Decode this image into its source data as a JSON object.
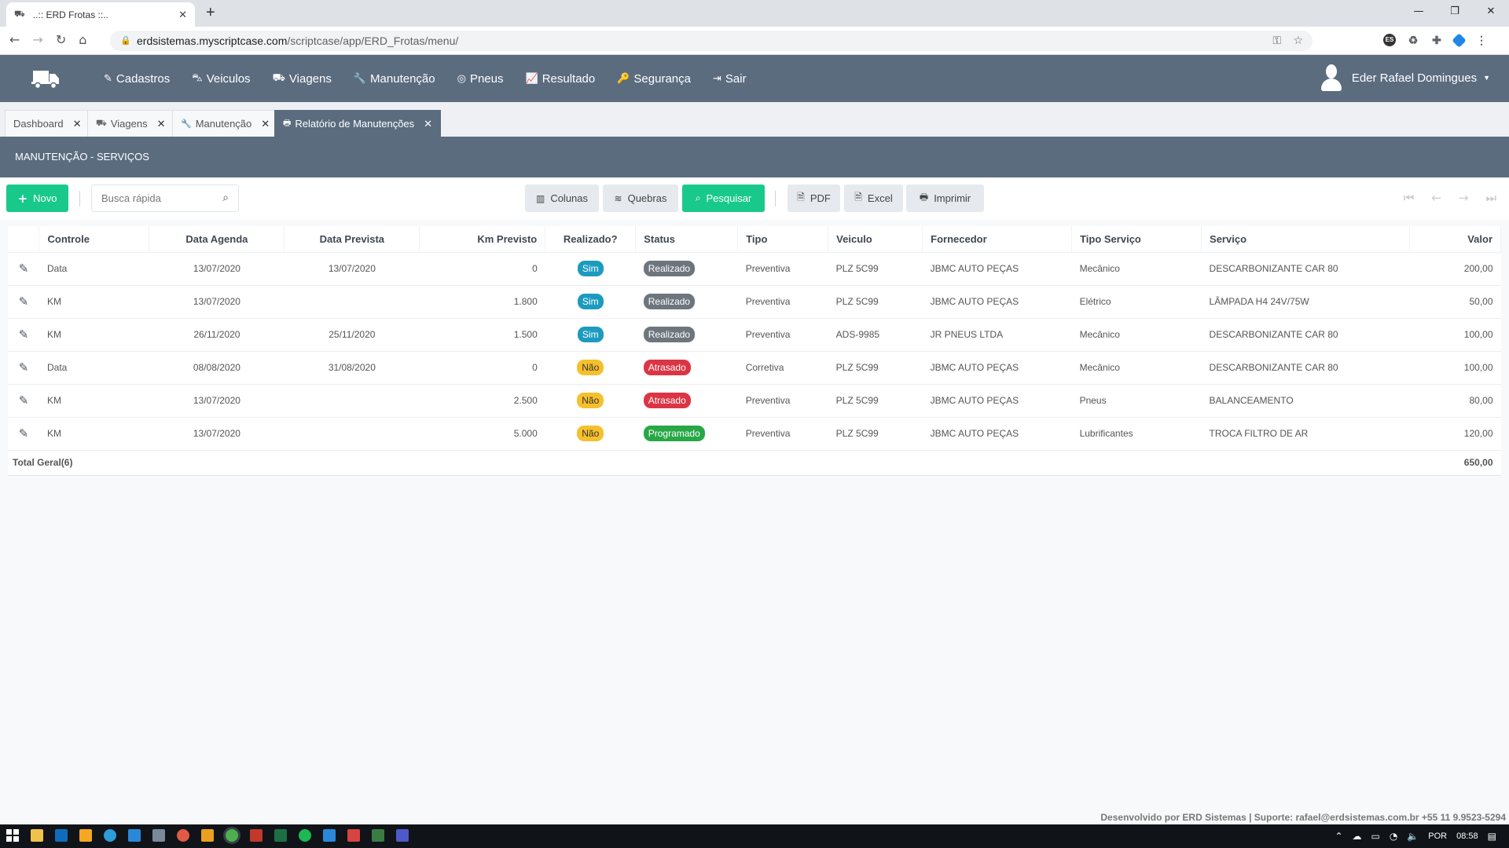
{
  "browser": {
    "tab_title": "..:: ERD Frotas ::..",
    "url_domain": "erdsistemas.myscriptcase.com",
    "url_path": "/scriptcase/app/ERD_Frotas/menu/"
  },
  "nav": {
    "items": [
      {
        "label": "Cadastros",
        "icon": "edit-icon"
      },
      {
        "label": "Veiculos",
        "icon": "car-icon"
      },
      {
        "label": "Viagens",
        "icon": "truck-icon"
      },
      {
        "label": "Manutenção",
        "icon": "wrench-icon"
      },
      {
        "label": "Pneus",
        "icon": "life-ring-icon"
      },
      {
        "label": "Resultado",
        "icon": "chart-icon"
      },
      {
        "label": "Segurança",
        "icon": "key-icon"
      },
      {
        "label": "Sair",
        "icon": "sign-out-icon"
      }
    ],
    "user_name": "Eder Rafael Domingues"
  },
  "app_tabs": [
    {
      "label": "Dashboard",
      "icon": ""
    },
    {
      "label": "Viagens",
      "icon": "truck-icon"
    },
    {
      "label": "Manutenção",
      "icon": "wrench-icon"
    },
    {
      "label": "Relatório de Manutenções",
      "icon": "print-icon"
    }
  ],
  "page_title": "MANUTENÇÃO - SERVIÇOS",
  "toolbar": {
    "new_label": "Novo",
    "search_placeholder": "Busca rápida",
    "columns_label": "Colunas",
    "breaks_label": "Quebras",
    "search_label": "Pesquisar",
    "pdf_label": "PDF",
    "excel_label": "Excel",
    "print_label": "Imprimir"
  },
  "table": {
    "headers": [
      "Controle",
      "Data Agenda",
      "Data Prevista",
      "Km Previsto",
      "Realizado?",
      "Status",
      "Tipo",
      "Veiculo",
      "Fornecedor",
      "Tipo Serviço",
      "Serviço",
      "Valor"
    ],
    "rows": [
      {
        "controle": "Data",
        "data_agenda": "13/07/2020",
        "data_prevista": "13/07/2020",
        "km": "0",
        "realizado": "Sim",
        "status": "Realizado",
        "tipo": "Preventiva",
        "veiculo": "PLZ 5C99",
        "fornecedor": "JBMC AUTO PEÇAS",
        "tipo_servico": "Mecânico",
        "servico": "DESCARBONIZANTE CAR 80",
        "valor": "200,00"
      },
      {
        "controle": "KM",
        "data_agenda": "13/07/2020",
        "data_prevista": "",
        "km": "1.800",
        "realizado": "Sim",
        "status": "Realizado",
        "tipo": "Preventiva",
        "veiculo": "PLZ 5C99",
        "fornecedor": "JBMC AUTO PEÇAS",
        "tipo_servico": "Elétrico",
        "servico": "LÂMPADA H4 24V/75W",
        "valor": "50,00"
      },
      {
        "controle": "KM",
        "data_agenda": "26/11/2020",
        "data_prevista": "25/11/2020",
        "km": "1.500",
        "realizado": "Sim",
        "status": "Realizado",
        "tipo": "Preventiva",
        "veiculo": "ADS-9985",
        "fornecedor": "JR PNEUS LTDA",
        "tipo_servico": "Mecânico",
        "servico": "DESCARBONIZANTE CAR 80",
        "valor": "100,00"
      },
      {
        "controle": "Data",
        "data_agenda": "08/08/2020",
        "data_prevista": "31/08/2020",
        "km": "0",
        "realizado": "Não",
        "status": "Atrasado",
        "tipo": "Corretiva",
        "veiculo": "PLZ 5C99",
        "fornecedor": "JBMC AUTO PEÇAS",
        "tipo_servico": "Mecânico",
        "servico": "DESCARBONIZANTE CAR 80",
        "valor": "100,00"
      },
      {
        "controle": "KM",
        "data_agenda": "13/07/2020",
        "data_prevista": "",
        "km": "2.500",
        "realizado": "Não",
        "status": "Atrasado",
        "tipo": "Preventiva",
        "veiculo": "PLZ 5C99",
        "fornecedor": "JBMC AUTO PEÇAS",
        "tipo_servico": "Pneus",
        "servico": "BALANCEAMENTO",
        "valor": "80,00"
      },
      {
        "controle": "KM",
        "data_agenda": "13/07/2020",
        "data_prevista": "",
        "km": "5.000",
        "realizado": "Não",
        "status": "Programado",
        "tipo": "Preventiva",
        "veiculo": "PLZ 5C99",
        "fornecedor": "JBMC AUTO PEÇAS",
        "tipo_servico": "Lubrificantes",
        "servico": "TROCA FILTRO DE AR",
        "valor": "120,00"
      }
    ],
    "total_label": "Total Geral(6)",
    "total_value": "650,00"
  },
  "footer": "Desenvolvido por ERD Sistemas | Suporte: rafael@erdsistemas.com.br +55 11 9.9523-5294",
  "taskbar": {
    "lang": "POR",
    "time": "08:58"
  },
  "colors": {
    "nav_bg": "#5b6c7f",
    "accent_green": "#19c98b",
    "pill_sim": "#1c9bbf",
    "pill_nao": "#f6c02d",
    "status_realizado": "#6d757d",
    "status_atrasado": "#db3545",
    "status_programado": "#27a745"
  }
}
